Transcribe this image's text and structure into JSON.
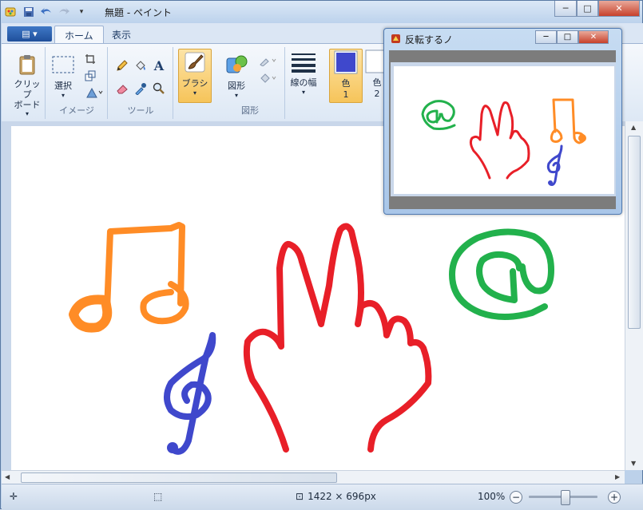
{
  "window": {
    "title": "無題 - ペイント",
    "controls": {
      "minimize": "─",
      "maximize": "□",
      "close": "✕"
    }
  },
  "qat": {
    "items": [
      "paint-app-icon",
      "save-icon",
      "undo-icon",
      "redo-icon",
      "dropdown-icon"
    ]
  },
  "tabs": [
    {
      "label": "ホーム",
      "active": true
    },
    {
      "label": "表示",
      "active": false
    }
  ],
  "file_menu_label": "▤ ▾",
  "ribbon": {
    "clipboard": {
      "label": "クリップ\nボード",
      "arrow": "▾"
    },
    "image": {
      "select_label": "選択",
      "arrow": "▾",
      "group_label": "イメージ"
    },
    "tools": {
      "group_label": "ツール"
    },
    "brush": {
      "label": "ブラシ",
      "arrow": "▾"
    },
    "shapes": {
      "label": "図形",
      "arrow": "▾",
      "group_label": "図形"
    },
    "size": {
      "label": "線の幅",
      "arrow": "▾"
    },
    "color1": {
      "label": "色",
      "number": "1",
      "color": "#3f48cc"
    },
    "color2": {
      "label": "色",
      "number": "2",
      "color": "#ffffff"
    }
  },
  "status": {
    "selection_size": "",
    "image_size": "1422 × 696px",
    "zoom": "100%",
    "zoom_out": "−",
    "zoom_in": "+"
  },
  "popup": {
    "title": "反転するノ",
    "controls": {
      "minimize": "─",
      "maximize": "□",
      "close": "✕"
    }
  },
  "colors": {
    "orange": "#ff8c26",
    "red": "#e81f28",
    "green": "#22b14c",
    "blue": "#3f48cc"
  }
}
